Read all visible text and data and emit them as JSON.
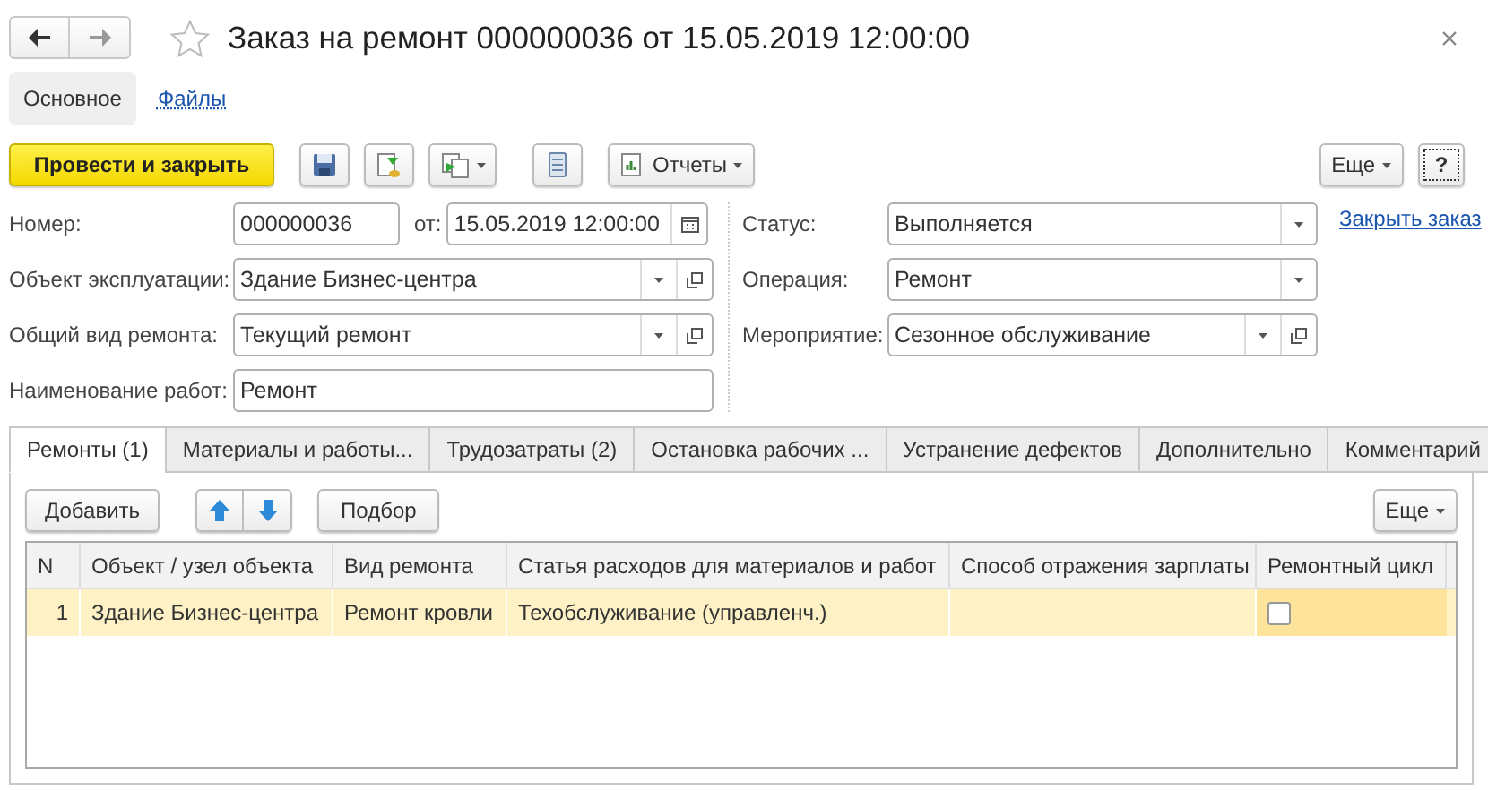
{
  "window": {
    "title": "Заказ на ремонт 000000036 от 15.05.2019 12:00:00",
    "favorite": false
  },
  "nav": [
    {
      "label": "Основное",
      "selected": true
    },
    {
      "label": "Файлы",
      "selected": false
    }
  ],
  "toolbar": {
    "primary": "Провести и закрыть",
    "reports": "Отчеты",
    "more": "Еще",
    "help": "?"
  },
  "fields_left": [
    {
      "kind": "number-date",
      "label": "Номер:",
      "value": "000000036",
      "date_label": "от:",
      "date_value": "15.05.2019 12:00:00"
    },
    {
      "kind": "select-open",
      "label": "Объект эксплуатации:",
      "value": "Здание Бизнес-центра"
    },
    {
      "kind": "select-open",
      "label": "Общий вид ремонта:",
      "value": "Текущий ремонт"
    },
    {
      "kind": "text",
      "label": "Наименование работ:",
      "value": "Ремонт"
    }
  ],
  "fields_right": [
    {
      "kind": "select",
      "label": "Статус:",
      "value": "Выполняется",
      "link": "Закрыть заказ"
    },
    {
      "kind": "select",
      "label": "Операция:",
      "value": "Ремонт"
    },
    {
      "kind": "select-open",
      "label": "Мероприятие:",
      "value": "Сезонное обслуживание"
    }
  ],
  "tabs": [
    {
      "label": "Ремонты (1)",
      "selected": true
    },
    {
      "label": "Материалы и работы...",
      "selected": false
    },
    {
      "label": "Трудозатраты (2)",
      "selected": false
    },
    {
      "label": "Остановка рабочих ...",
      "selected": false
    },
    {
      "label": "Устранение дефектов",
      "selected": false
    },
    {
      "label": "Дополнительно",
      "selected": false
    },
    {
      "label": "Комментарий",
      "selected": false
    }
  ],
  "table_toolbar": {
    "add": "Добавить",
    "pick": "Подбор",
    "more": "Еще"
  },
  "table": {
    "columns": [
      "N",
      "Объект / узел объекта",
      "Вид ремонта",
      "Статья расходов для материалов и работ",
      "Способ отражения зарплаты",
      "Ремонтный цикл"
    ],
    "rows": [
      {
        "cells": [
          "1",
          "Здание Бизнес-центра",
          "Ремонт кровли",
          "Техобслуживание (управленч.)",
          ""
        ],
        "repair_cycle": false,
        "selected": true
      }
    ]
  }
}
